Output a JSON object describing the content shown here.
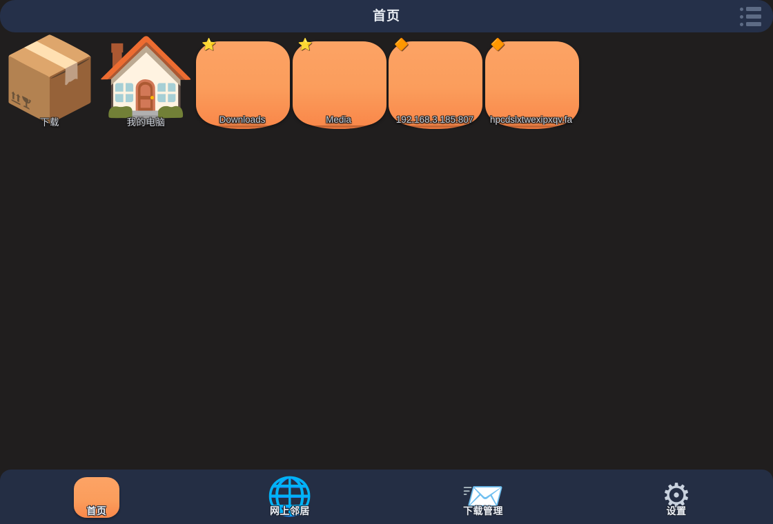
{
  "header": {
    "title": "首页",
    "menu_icon": "list-menu-icon",
    "background_color": "#253049"
  },
  "theme": {
    "page_background": "#201e1e",
    "accent_orange": "#fb9d5c",
    "nav_background": "#242e44",
    "label_color": "#cfd4dc"
  },
  "desktop": {
    "items": [
      {
        "label": "下载",
        "kind": "emoji",
        "icon": "package-box-icon",
        "glyph": "📦",
        "star": null,
        "is_cjk": true
      },
      {
        "label": "我的电脑",
        "kind": "emoji",
        "icon": "house-icon",
        "glyph": "🏠",
        "star": null,
        "is_cjk": true
      },
      {
        "label": "Downloads",
        "kind": "folder",
        "icon": "orange-folder-icon",
        "star": "⭐",
        "star_color": "#f5c518",
        "is_cjk": false
      },
      {
        "label": "Media",
        "kind": "folder",
        "icon": "orange-folder-icon",
        "star": "⭐",
        "star_color": "#f5c518",
        "is_cjk": false
      },
      {
        "label": "192.168.3.185:807",
        "kind": "folder",
        "icon": "orange-folder-icon",
        "star": "🔶",
        "star_color": "#e8551b",
        "is_cjk": false
      },
      {
        "label": "hpcdslxtwexipxqv.fa",
        "kind": "folder",
        "icon": "orange-folder-icon",
        "star": "🔶",
        "star_color": "#e8551b",
        "is_cjk": false
      }
    ]
  },
  "bottom_nav": {
    "items": [
      {
        "label": "首页",
        "icon": "home-tile-icon",
        "kind": "tile",
        "glyph": "",
        "active": true
      },
      {
        "label": "网上邻居",
        "icon": "globe-icon",
        "kind": "emoji",
        "glyph": "🌐",
        "active": false
      },
      {
        "label": "下载管理",
        "icon": "paper-plane-icon",
        "kind": "emoji",
        "glyph": "📨",
        "active": false
      },
      {
        "label": "设置",
        "icon": "gears-icon",
        "kind": "emoji",
        "glyph": "⚙",
        "active": false
      }
    ]
  }
}
